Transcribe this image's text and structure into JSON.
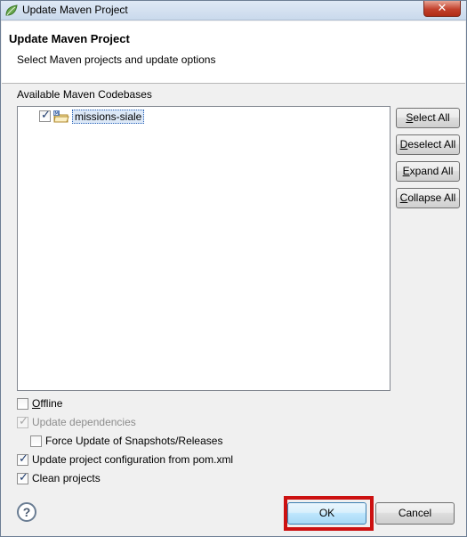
{
  "window": {
    "title": "Update Maven Project",
    "close_glyph": "✕"
  },
  "header": {
    "title": "Update Maven Project",
    "description": "Select Maven projects and update options"
  },
  "codebases": {
    "label": "Available Maven Codebases",
    "items": [
      {
        "label": "missions-siale",
        "checked": true,
        "icon": "maven-project-folder-icon"
      }
    ]
  },
  "side_buttons": {
    "select_all": {
      "mnemonic": "S",
      "rest": "elect All"
    },
    "deselect_all": {
      "mnemonic": "D",
      "rest": "eselect All"
    },
    "expand_all": {
      "mnemonic": "E",
      "rest": "xpand All"
    },
    "collapse_all": {
      "mnemonic": "C",
      "rest": "ollapse All"
    }
  },
  "options": {
    "offline": {
      "mnemonic": "O",
      "rest": "ffline",
      "checked": false
    },
    "update_dependencies": {
      "label": "Update dependencies",
      "checked": true,
      "disabled": true
    },
    "force_update": {
      "label": "Force Update of Snapshots/Releases",
      "checked": false
    },
    "update_config": {
      "label": "Update project configuration from pom.xml",
      "checked": true
    },
    "clean_projects": {
      "label": "Clean projects",
      "checked": true
    }
  },
  "footer": {
    "help_glyph": "?",
    "ok_label": "OK",
    "cancel_label": "Cancel"
  },
  "colors": {
    "highlight": "#cc1111",
    "selection": "#dce8f7"
  }
}
